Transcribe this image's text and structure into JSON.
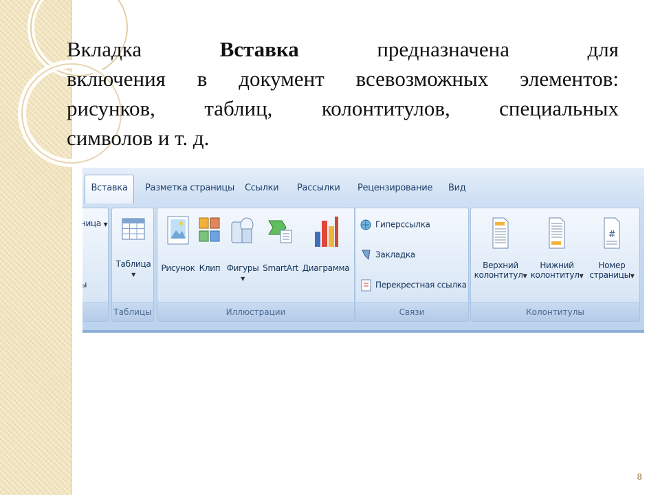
{
  "slide": {
    "line1_a": "Вкладка",
    "line1_b": "Вставка",
    "line1_c": "предназначена",
    "line1_d": "для",
    "line2": "включения в документ всевозможных элементов:",
    "line3": "рисунков, таблиц, колонтитулов, специальных",
    "line4": "символов и т. д.",
    "page_number": "8"
  },
  "ribbon": {
    "tabs": [
      "Вставка",
      "Разметка страницы",
      "Ссылки",
      "Рассылки",
      "Рецензирование",
      "Вид"
    ],
    "active_tab": "Вставка",
    "partial_group": {
      "label_top": "ница",
      "label_mid": "ы"
    },
    "groups": {
      "tables": {
        "label": "Таблицы",
        "buttons": {
          "table": "Таблица"
        }
      },
      "illustrations": {
        "label": "Иллюстрации",
        "buttons": {
          "picture": "Рисунок",
          "clip": "Клип",
          "shapes": "Фигуры",
          "smartart": "SmartArt",
          "chart": "Диаграмма"
        }
      },
      "links": {
        "label": "Связи",
        "buttons": {
          "hyperlink": "Гиперссылка",
          "bookmark": "Закладка",
          "cross_ref": "Перекрестная ссылка"
        }
      },
      "header_footer": {
        "label": "Колонтитулы",
        "buttons": {
          "header_1": "Верхний",
          "header_2": "колонтитул",
          "footer_1": "Нижний",
          "footer_2": "колонтитул",
          "pagenum_1": "Номер",
          "pagenum_2": "страницы"
        }
      }
    },
    "colors": {
      "accent": "#1f3f6b",
      "ribbon_bg": "#c9dcf1",
      "border": "#8eaed8"
    }
  }
}
